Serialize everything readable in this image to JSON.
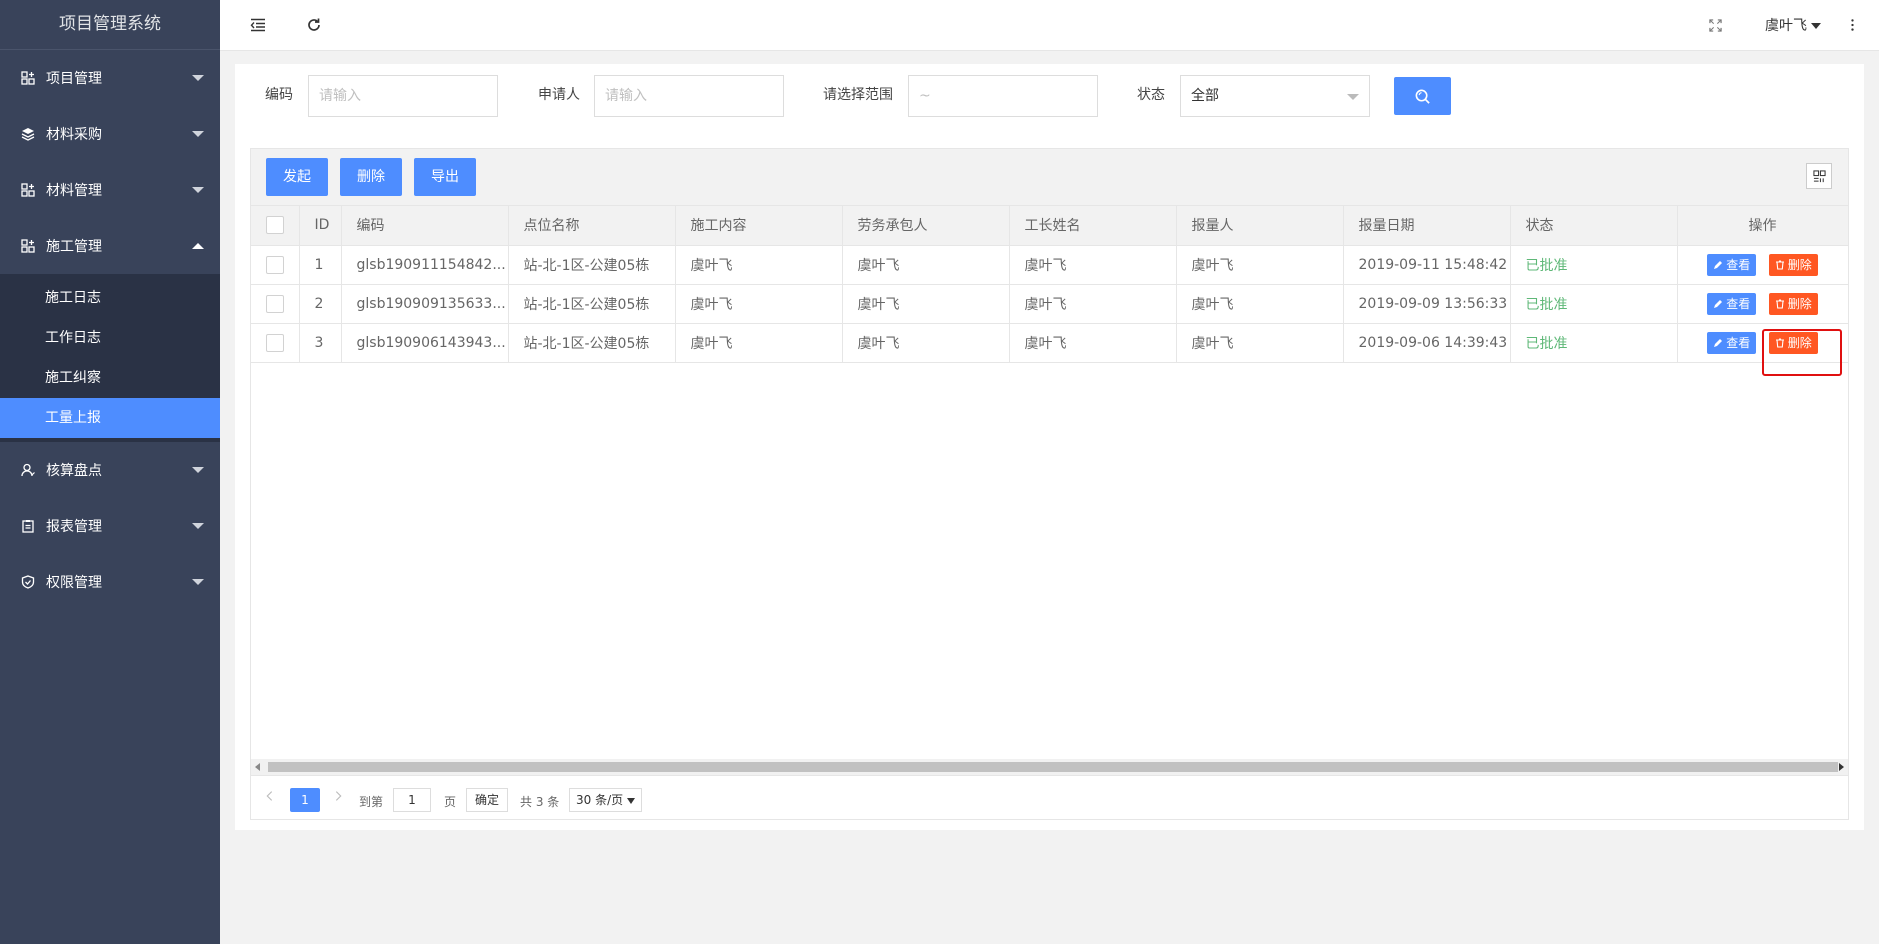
{
  "app_title": "项目管理系统",
  "sidebar": {
    "items": [
      {
        "label": "项目管理",
        "icon": "grid-plus-icon"
      },
      {
        "label": "材料采购",
        "icon": "layers-icon"
      },
      {
        "label": "材料管理",
        "icon": "grid-plus-icon"
      },
      {
        "label": "施工管理",
        "icon": "grid-plus-icon",
        "expanded": true,
        "children": [
          "施工日志",
          "工作日志",
          "施工纠察",
          "工量上报"
        ],
        "active_child": "工量上报"
      },
      {
        "label": "核算盘点",
        "icon": "user-icon"
      },
      {
        "label": "报表管理",
        "icon": "clipboard-icon"
      },
      {
        "label": "权限管理",
        "icon": "shield-icon"
      }
    ]
  },
  "header": {
    "user": "虞叶飞"
  },
  "search": {
    "code_label": "编码",
    "code_placeholder": "请输入",
    "applicant_label": "申请人",
    "applicant_placeholder": "请输入",
    "range_label": "请选择范围",
    "range_placeholder": "~",
    "status_label": "状态",
    "status_value": "全部"
  },
  "toolbar": {
    "start_label": "发起",
    "delete_label": "删除",
    "export_label": "导出"
  },
  "table": {
    "headers": [
      "ID",
      "编码",
      "点位名称",
      "施工内容",
      "劳务承包人",
      "工长姓名",
      "报量人",
      "报量日期",
      "状态",
      "操作"
    ],
    "rows": [
      {
        "id": "1",
        "code": "glsb190911154842...",
        "location": "站-北-1区-公建05栋",
        "content": "虞叶飞",
        "contractor": "虞叶飞",
        "foreman": "虞叶飞",
        "reporter": "虞叶飞",
        "date": "2019-09-11 15:48:42",
        "status": "已批准"
      },
      {
        "id": "2",
        "code": "glsb190909135633...",
        "location": "站-北-1区-公建05栋",
        "content": "虞叶飞",
        "contractor": "虞叶飞",
        "foreman": "虞叶飞",
        "reporter": "虞叶飞",
        "date": "2019-09-09 13:56:33",
        "status": "已批准"
      },
      {
        "id": "3",
        "code": "glsb190906143943...",
        "location": "站-北-1区-公建05栋",
        "content": "虞叶飞",
        "contractor": "虞叶飞",
        "foreman": "虞叶飞",
        "reporter": "虞叶飞",
        "date": "2019-09-06 14:39:43",
        "status": "已批准"
      }
    ],
    "view_label": "查看",
    "delete_label": "删除"
  },
  "pager": {
    "current": "1",
    "goto_label": "到第",
    "goto_value": "1",
    "page_unit": "页",
    "confirm_label": "确定",
    "total_label": "共 3 条",
    "page_size": "30 条/页"
  },
  "colors": {
    "sidebar_bg": "#39435a",
    "submenu_bg": "#2a3245",
    "primary": "#4e8dff",
    "danger": "#ff5722",
    "status_ok": "#5fb878",
    "highlight": "#e01010"
  }
}
